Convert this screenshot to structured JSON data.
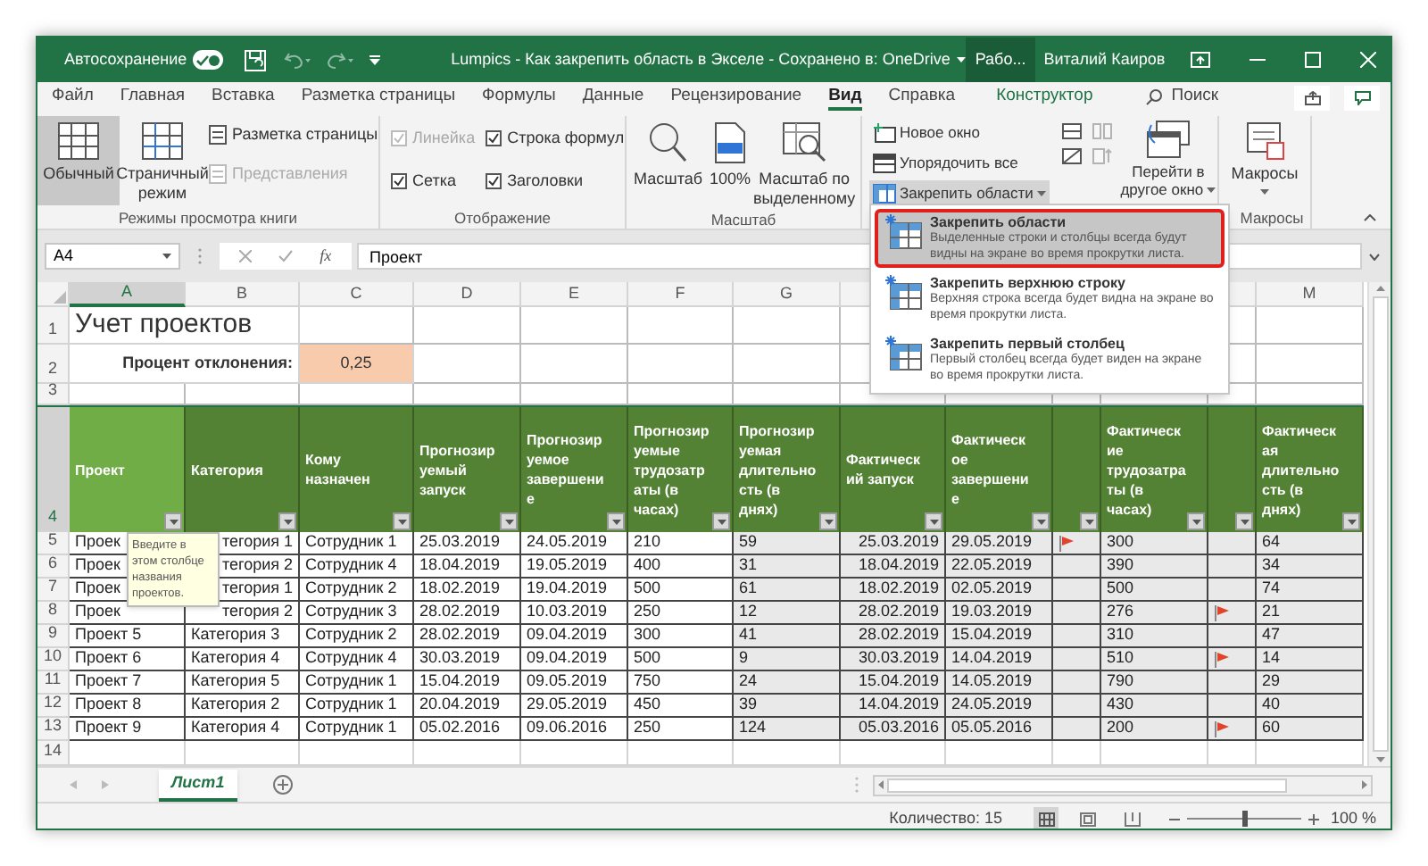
{
  "title_bar": {
    "autosave": {
      "label": "Автосохранение",
      "on": true
    },
    "document_title": "Lumpics - Как закрепить область в Экселе - Сохранено в: OneDrive",
    "workspace_button": "Рабо...",
    "user_name": "Виталий Каиров"
  },
  "ribbon_tabs": [
    {
      "label": "Файл",
      "kind": "normal",
      "selected": false
    },
    {
      "label": "Главная",
      "kind": "normal",
      "selected": false
    },
    {
      "label": "Вставка",
      "kind": "normal",
      "selected": false
    },
    {
      "label": "Разметка страницы",
      "kind": "normal",
      "selected": false
    },
    {
      "label": "Формулы",
      "kind": "normal",
      "selected": false
    },
    {
      "label": "Данные",
      "kind": "normal",
      "selected": false
    },
    {
      "label": "Рецензирование",
      "kind": "normal",
      "selected": false
    },
    {
      "label": "Вид",
      "kind": "normal",
      "selected": true
    },
    {
      "label": "Справка",
      "kind": "normal",
      "selected": false
    },
    {
      "label": "Конструктор",
      "kind": "contextual",
      "selected": false
    }
  ],
  "search": {
    "placeholder": "Поиск"
  },
  "ribbon": {
    "view_modes": {
      "label": "Режимы просмотра книги",
      "large": [
        {
          "label": "Обычный",
          "selected": true
        },
        {
          "label": "Страничный режим",
          "selected": false
        }
      ],
      "small": [
        {
          "label": "Разметка страницы",
          "disabled": false
        },
        {
          "label": "Представления",
          "disabled": true
        }
      ]
    },
    "show": {
      "label": "Отображение",
      "checkboxes": [
        {
          "label": "Линейка",
          "checked": true,
          "disabled": true
        },
        {
          "label": "Строка формул",
          "checked": true,
          "disabled": false
        },
        {
          "label": "Сетка",
          "checked": true,
          "disabled": false
        },
        {
          "label": "Заголовки",
          "checked": true,
          "disabled": false
        }
      ]
    },
    "zoom": {
      "label": "Масштаб",
      "buttons": [
        {
          "label": "Масштаб",
          "kind": "magnifier"
        },
        {
          "label": "100%",
          "kind": "page"
        },
        {
          "label": "Масштаб по выделенному",
          "kind": "selection"
        }
      ]
    },
    "window": {
      "small": [
        {
          "label": "Новое окно",
          "kind": "new",
          "pressed": false
        },
        {
          "label": "Упорядочить все",
          "kind": "arrange",
          "pressed": false
        },
        {
          "label": "Закрепить области",
          "kind": "freeze",
          "pressed": true
        }
      ],
      "switch_windows": "Перейти в другое окно"
    },
    "macros": {
      "label": "Макросы",
      "button": "Макросы"
    }
  },
  "freeze_menu": [
    {
      "title": "Закрепить области",
      "description": "Выделенные строки и столбцы всегда будут видны на экране во время прокрутки листа.",
      "selected": true
    },
    {
      "title": "Закрепить верхнюю строку",
      "description": "Верхняя строка всегда будет видна на экране во время прокрутки листа.",
      "selected": false
    },
    {
      "title": "Закрепить первый столбец",
      "description": "Первый столбец всегда будет виден на экране во время прокрутки листа.",
      "selected": false
    }
  ],
  "formula_bar": {
    "name_box": "A4",
    "function_label": "fx",
    "value": "Проект"
  },
  "sheet": {
    "columns": [
      {
        "letter": "A",
        "selected": true
      },
      {
        "letter": "B",
        "selected": false
      },
      {
        "letter": "C",
        "selected": false
      },
      {
        "letter": "D",
        "selected": false
      },
      {
        "letter": "E",
        "selected": false
      },
      {
        "letter": "F",
        "selected": false
      },
      {
        "letter": "G",
        "selected": false
      },
      {},
      {},
      {},
      {},
      {},
      {
        "letter": "M",
        "selected": false
      }
    ],
    "top_rows": [
      "1",
      "2",
      "3",
      "4"
    ],
    "title": "Учет проектов",
    "deviation_label": "Процент отклонения:",
    "deviation_value": "0,25",
    "headers": [
      {
        "text": "Проект",
        "selected": true
      },
      {
        "text": "Категория",
        "selected": false
      },
      {
        "text": "Кому назначен",
        "selected": false
      },
      {
        "text": "Прогнозируемый запуск",
        "selected": false
      },
      {
        "text": "Прогнозируемое завершение",
        "selected": false
      },
      {
        "text": "Прогнозируемые трудозатраты (в часах)",
        "selected": false
      },
      {
        "text": "Прогнозируемая длительность (в днях)",
        "selected": false
      },
      {
        "text": "Фактический запуск",
        "selected": false
      },
      {
        "text": "Фактическое завершение",
        "selected": false
      },
      {
        "text": "Фактические трудозатраты (в часах)",
        "selected": false
      },
      {
        "text": "Фактическая длительность (в днях)",
        "selected": false
      }
    ],
    "rows": [
      {
        "number": "5",
        "values": [
          "Проек",
          "тегория 1",
          "Сотрудник 1",
          "25.03.2019",
          "24.05.2019",
          "210",
          "59",
          "25.03.2019",
          "29.05.2019",
          "300",
          "64"
        ],
        "flags": [
          true,
          false
        ]
      },
      {
        "number": "6",
        "values": [
          "Проек",
          "тегория 2",
          "Сотрудник 4",
          "18.04.2019",
          "19.05.2019",
          "400",
          "31",
          "18.04.2019",
          "22.05.2019",
          "390",
          "34"
        ],
        "flags": [
          false,
          false
        ]
      },
      {
        "number": "7",
        "values": [
          "Проек",
          "тегория 1",
          "Сотрудник 2",
          "18.02.2019",
          "19.04.2019",
          "500",
          "61",
          "18.02.2019",
          "02.05.2019",
          "500",
          "74"
        ],
        "flags": [
          false,
          false
        ]
      },
      {
        "number": "8",
        "values": [
          "Проек",
          "тегория 2",
          "Сотрудник 3",
          "28.02.2019",
          "10.03.2019",
          "250",
          "12",
          "28.02.2019",
          "19.03.2019",
          "276",
          "21"
        ],
        "flags": [
          false,
          true
        ]
      },
      {
        "number": "9",
        "values": [
          "Проект 5",
          "Категория 3",
          "Сотрудник 2",
          "28.02.2019",
          "09.04.2019",
          "300",
          "41",
          "28.02.2019",
          "15.04.2019",
          "310",
          "47"
        ],
        "flags": [
          false,
          false
        ]
      },
      {
        "number": "10",
        "values": [
          "Проект 6",
          "Категория 4",
          "Сотрудник 4",
          "30.03.2019",
          "09.04.2019",
          "500",
          "9",
          "30.03.2019",
          "14.04.2019",
          "510",
          "14"
        ],
        "flags": [
          false,
          true
        ]
      },
      {
        "number": "11",
        "values": [
          "Проект 7",
          "Категория 5",
          "Сотрудник 1",
          "15.04.2019",
          "09.05.2019",
          "750",
          "24",
          "15.04.2019",
          "14.05.2019",
          "790",
          "29"
        ],
        "flags": [
          false,
          false
        ]
      },
      {
        "number": "12",
        "values": [
          "Проект 8",
          "Категория 2",
          "Сотрудник 1",
          "20.04.2019",
          "29.05.2019",
          "450",
          "39",
          "14.04.2019",
          "24.05.2019",
          "430",
          "40"
        ],
        "flags": [
          false,
          false
        ]
      },
      {
        "number": "13",
        "values": [
          "Проект 9",
          "Категория 4",
          "Сотрудник 1",
          "05.02.2016",
          "09.06.2016",
          "250",
          "124",
          "05.03.2016",
          "05.05.2016",
          "200",
          "60"
        ],
        "flags": [
          false,
          true
        ]
      }
    ],
    "empty_row_number": "14"
  },
  "tooltip": {
    "text": "Введите в этом столбце названия проектов."
  },
  "sheet_tabs": [
    {
      "label": "Лист1",
      "selected": true
    }
  ],
  "status_bar": {
    "count": "Количество: 15",
    "zoom_slider": {
      "level": 0.5
    },
    "zoom_label": "100 %"
  }
}
